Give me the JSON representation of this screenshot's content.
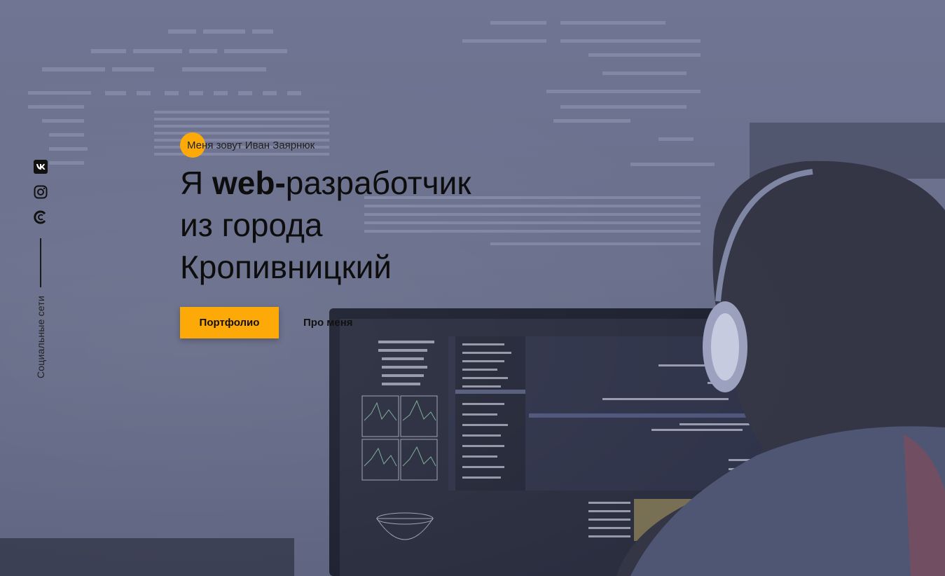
{
  "social": {
    "items": [
      {
        "icon": "vk-icon"
      },
      {
        "icon": "instagram-icon"
      },
      {
        "icon": "codepen-icon"
      }
    ],
    "label": "Социальные сети"
  },
  "hero": {
    "intro": "Меня зовут Иван Заярнюк",
    "headline": {
      "prefix": "Я ",
      "highlight": "web-",
      "line1_rest": "разработчик",
      "line2": "из города",
      "line3": "Кропивницкий"
    },
    "primary_button": "Портфолио",
    "secondary_link": "Про меня"
  },
  "colors": {
    "accent": "#fdaa09",
    "background": "#6a708c",
    "text": "#0d0d0d"
  }
}
